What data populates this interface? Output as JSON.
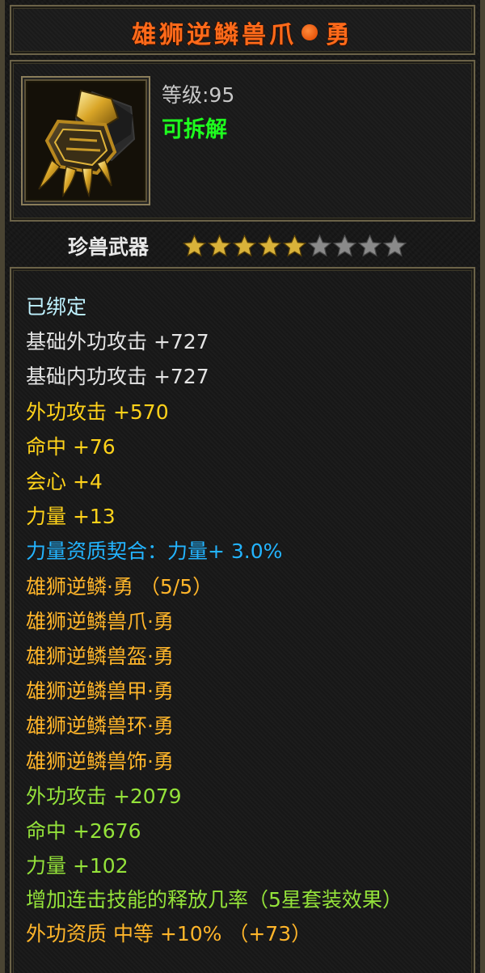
{
  "item": {
    "name": "雄狮逆鳞兽爪",
    "grade": "勇",
    "level_text": "等级:95",
    "decompose_text": "可拆解",
    "icon": "golden-beast-claw-icon"
  },
  "rank": {
    "label": "珍兽武器",
    "stars_filled": 5,
    "stars_total": 9,
    "star_colors": {
      "filled": "#d9b23a",
      "empty": "#8a8a8a"
    }
  },
  "stats": {
    "bound": "已绑定",
    "base": [
      "基础外功攻击 +727",
      "基础内功攻击 +727"
    ],
    "bonus": [
      "外功攻击 +570",
      "命中 +76",
      "会心 +4",
      "力量 +13"
    ],
    "aptitude": "力量资质契合：力量+ 3.0%",
    "set_title": "雄狮逆鳞·勇 （5/5）",
    "set_pieces": [
      "雄狮逆鳞兽爪·勇",
      "雄狮逆鳞兽盔·勇",
      "雄狮逆鳞兽甲·勇",
      "雄狮逆鳞兽环·勇",
      "雄狮逆鳞兽饰·勇"
    ],
    "set_bonus": [
      "外功攻击 +2079",
      "命中 +2676",
      "力量 +102"
    ],
    "set_effect": "增加连击技能的释放几率（5星套装效果）",
    "partial_line": "外功资质  中等  +10% （+73）"
  },
  "colors": {
    "title": "#ff6a1a",
    "bound": "#bff2ff",
    "base": "#e4e4e4",
    "bonus": "#ffd21a",
    "aptitude": "#23b4ff",
    "set": "#ffb52a",
    "set_bonus": "#94e23a",
    "decompose": "#1eff1e"
  }
}
